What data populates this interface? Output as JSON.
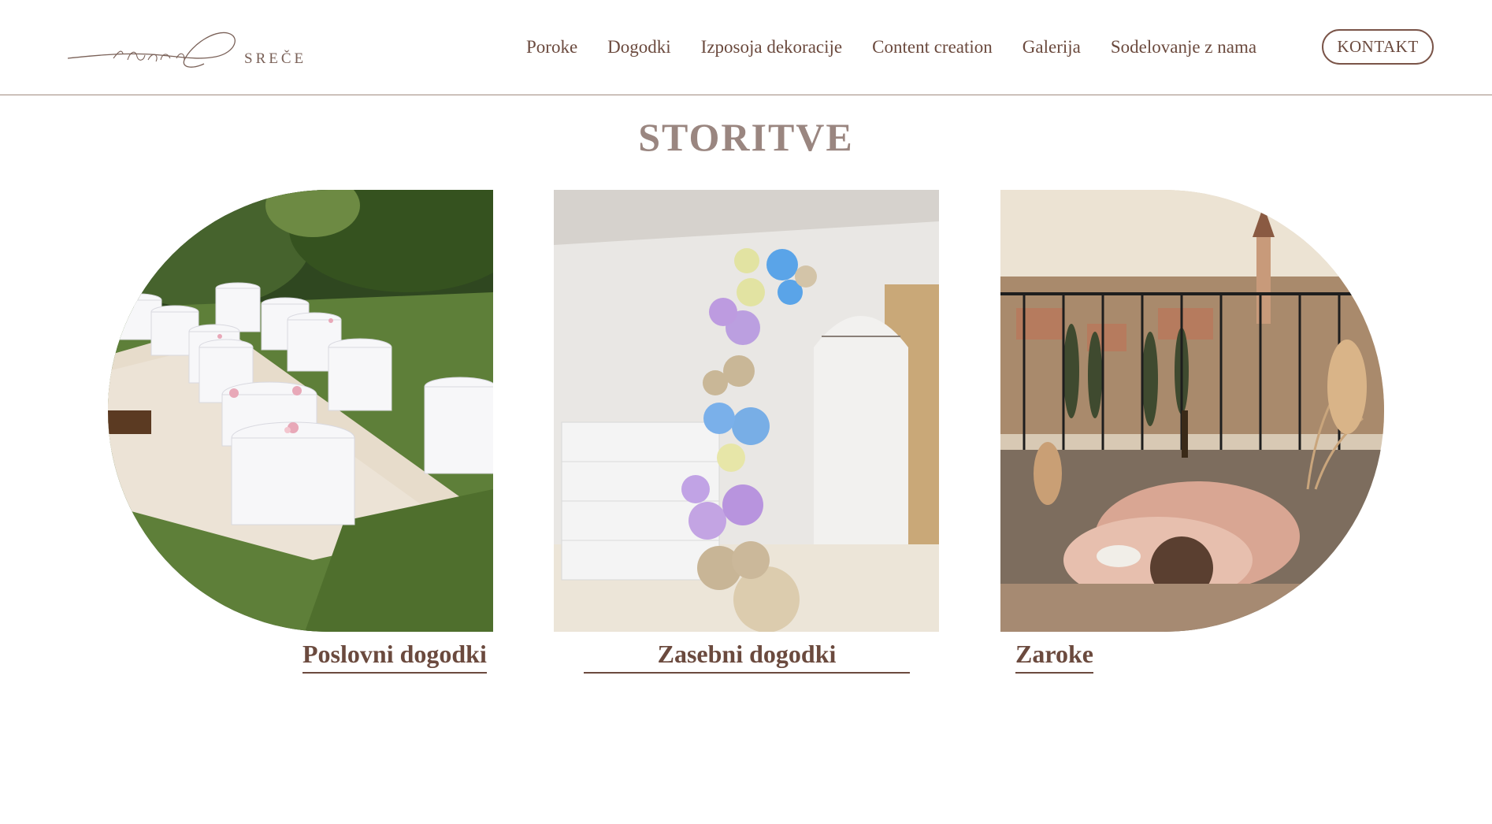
{
  "brand": {
    "script": "iskrica",
    "word": "SREČE"
  },
  "nav": {
    "items": [
      "Poroke",
      "Dogodki",
      "Izposoja dekoracije",
      "Content creation",
      "Galerija",
      "Sodelovanje z nama"
    ],
    "cta": "KONTAKT"
  },
  "section": {
    "title": "STORITVE"
  },
  "cards": [
    {
      "label": "Poslovni dogodki"
    },
    {
      "label": "Zasebni dogodki"
    },
    {
      "label": "Zaroke"
    }
  ],
  "colors": {
    "accent": "#6b4a3e",
    "title": "#9a8680",
    "divider": "#a08a80"
  }
}
